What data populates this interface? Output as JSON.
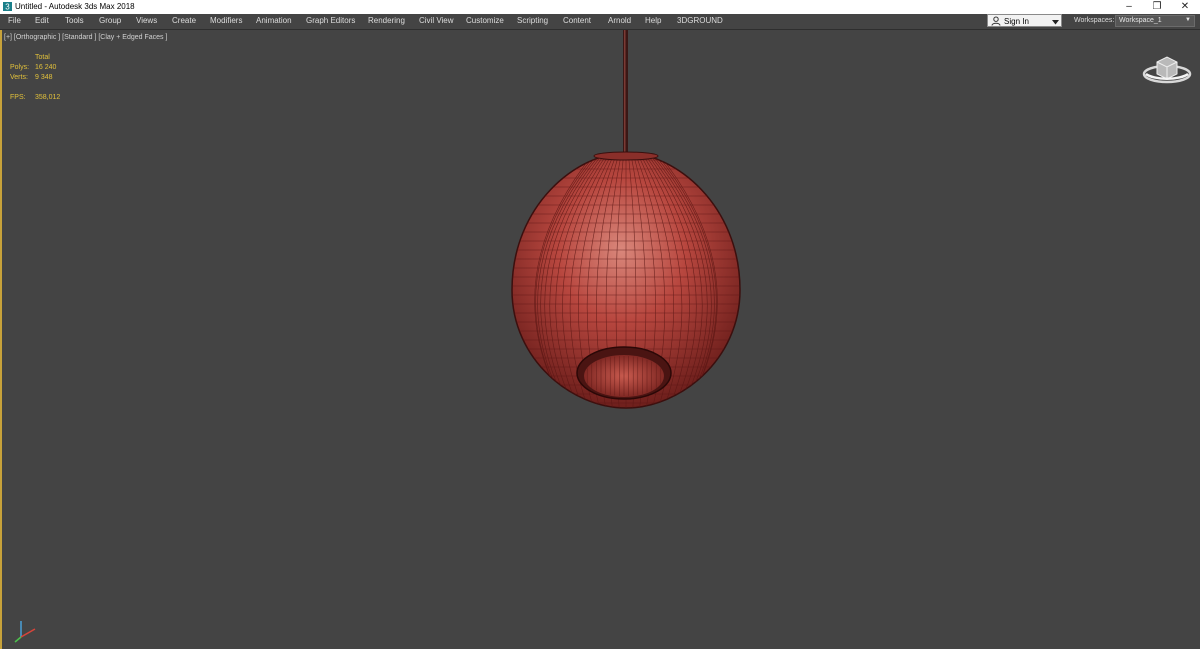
{
  "window": {
    "title": "Untitled - Autodesk 3ds Max 2018",
    "controls": [
      "minimize-icon",
      "restore-icon",
      "close-icon"
    ]
  },
  "menu": {
    "items": [
      "File",
      "Edit",
      "Tools",
      "Group",
      "Views",
      "Create",
      "Modifiers",
      "Animation",
      "Graph Editors",
      "Rendering",
      "Civil View",
      "Customize",
      "Scripting",
      "Content",
      "Arnold",
      "Help",
      "3DGROUND"
    ]
  },
  "account": {
    "sign_in": "Sign In"
  },
  "workspace": {
    "label": "Workspaces:",
    "value": "Workspace_1"
  },
  "viewport": {
    "label": "[+] [Orthographic ] [Standard ] [Clay + Edged Faces ]",
    "stats": {
      "total_label": "Total",
      "polys_label": "Polys:",
      "polys_value": "16 240",
      "verts_label": "Verts:",
      "verts_value": "9 348",
      "fps_label": "FPS:",
      "fps_value": "358,012"
    }
  },
  "colors": {
    "viewport_bg": "#444444",
    "stats_text": "#e2c13b",
    "active_border": "#c7a23a",
    "model_clay": "#b5443e"
  }
}
